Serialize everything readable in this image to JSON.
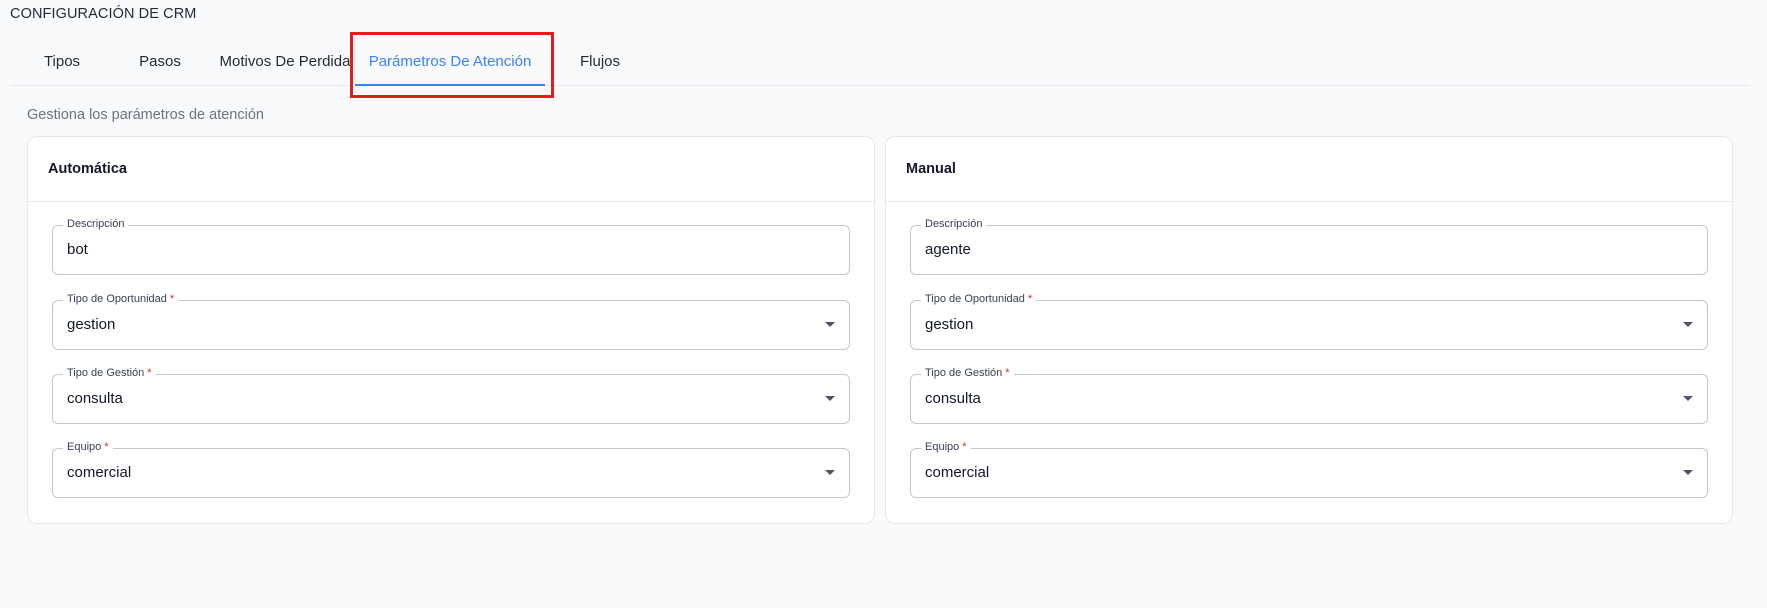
{
  "page": {
    "title": "CONFIGURACIÓN DE CRM",
    "subtitle": "Gestiona los parámetros de atención"
  },
  "tabs": [
    {
      "label": "Tipos",
      "active": false
    },
    {
      "label": "Pasos",
      "active": false
    },
    {
      "label": "Motivos De Perdida",
      "active": false
    },
    {
      "label": "Parámetros De Atención",
      "active": true
    },
    {
      "label": "Flujos",
      "active": false
    }
  ],
  "colors": {
    "accent": "#3b82f6",
    "highlight": "#e11d1d",
    "required": "#dc2626"
  },
  "cards": [
    {
      "title": "Automática",
      "fields": {
        "descripcion": {
          "label": "Descripción",
          "value": "bot"
        },
        "tipo_oportunidad": {
          "label": "Tipo de Oportunidad",
          "value": "gestion",
          "required_mark": "*"
        },
        "tipo_gestion": {
          "label": "Tipo de Gestión",
          "value": "consulta",
          "required_mark": "*"
        },
        "equipo": {
          "label": "Equipo",
          "value": "comercial",
          "required_mark": "*"
        }
      }
    },
    {
      "title": "Manual",
      "fields": {
        "descripcion": {
          "label": "Descripción",
          "value": "agente"
        },
        "tipo_oportunidad": {
          "label": "Tipo de Oportunidad",
          "value": "gestion",
          "required_mark": "*"
        },
        "tipo_gestion": {
          "label": "Tipo de Gestión",
          "value": "consulta",
          "required_mark": "*"
        },
        "equipo": {
          "label": "Equipo",
          "value": "comercial",
          "required_mark": "*"
        }
      }
    }
  ]
}
